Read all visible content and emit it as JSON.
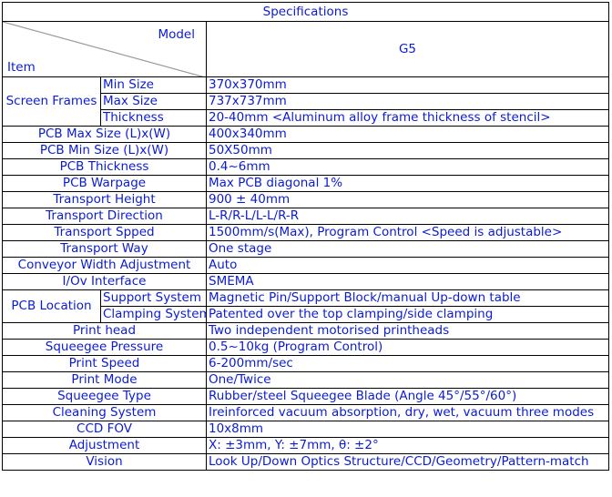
{
  "title": "Specifications",
  "header": {
    "model_label": "Model",
    "item_label": "Item",
    "model_name": "G5"
  },
  "rows": [
    {
      "group": "Screen Frames",
      "label": "Min Size",
      "value": "370x370mm"
    },
    {
      "label": "Max Size",
      "value": "737x737mm"
    },
    {
      "label": "Thickness",
      "value": "20-40mm <Aluminum alloy frame thickness of stencil>"
    },
    {
      "label": "PCB Max Size (L)x(W)",
      "value": "400x340mm"
    },
    {
      "label": "PCB Min Size (L)x(W)",
      "value": "50X50mm"
    },
    {
      "label": "PCB Thickness",
      "value": "0.4~6mm"
    },
    {
      "label": "PCB Warpage",
      "value": "Max PCB diagonal 1%"
    },
    {
      "label": "Transport Height",
      "value": "900 ± 40mm"
    },
    {
      "label": "Transport Direction",
      "value": "L-R/R-L/L-L/R-R"
    },
    {
      "label": "Transport Spped",
      "value": "1500mm/s(Max), Program Control <Speed is adjustable>"
    },
    {
      "label": "Transport Way",
      "value": "One stage"
    },
    {
      "label": "Conveyor Width Adjustment",
      "value": "Auto"
    },
    {
      "label": "I/Ov Interface",
      "value": "SMEMA"
    },
    {
      "group": "PCB Location",
      "label": "Support System",
      "value": "Magnetic Pin/Support Block/manual Up-down table"
    },
    {
      "label": "Clamping System",
      "value": "Patented over the top clamping/side clamping"
    },
    {
      "label": "Print head",
      "value": "Two independent motorised printheads"
    },
    {
      "label": "Squeegee Pressure",
      "value": "0.5~10kg (Program Control)"
    },
    {
      "label": "Print Speed",
      "value": "6-200mm/sec"
    },
    {
      "label": "Print Mode",
      "value": "One/Twice"
    },
    {
      "label": "Squeegee Type",
      "value": "Rubber/steel Squeegee Blade (Angle 45°/55°/60°)"
    },
    {
      "label": "Cleaning System",
      "value": "Ireinforced vacuum absorption, dry, wet, vacuum three modes"
    },
    {
      "label": "CCD FOV",
      "value": "10x8mm"
    },
    {
      "label": "Adjustment",
      "value": "X: ±3mm, Y: ±7mm, θ: ±2°"
    },
    {
      "label": "Vision",
      "value": "Look Up/Down Optics Structure/CCD/Geometry/Pattern-match"
    }
  ]
}
